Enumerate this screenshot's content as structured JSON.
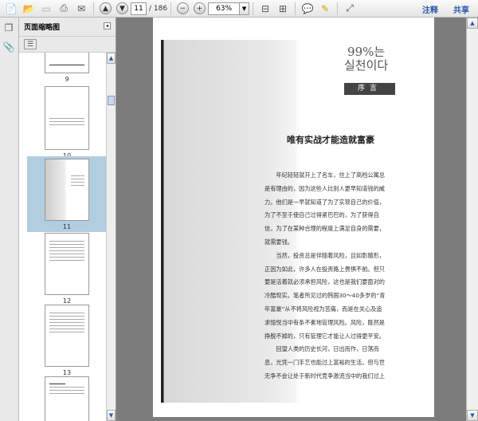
{
  "toolbar": {
    "current_page": "11",
    "total_pages": "/ 186",
    "zoom": "63%",
    "annotate": "注释",
    "share": "共享"
  },
  "sidebar": {
    "title": "页面缩略图",
    "thumbnails": [
      {
        "label": "9"
      },
      {
        "label": "10"
      },
      {
        "label": "11"
      },
      {
        "label": "12"
      },
      {
        "label": "13"
      }
    ]
  },
  "document": {
    "korean_title": [
      "99%는",
      "실천이다"
    ],
    "section": "序言",
    "heading": "唯有实战才能造就富豪",
    "lines": [
      "　　年纪轻轻就开上了名车，住上了高档公寓总",
      "是有理由的，因为这些人比别人更早知道钱的威",
      "力。他们是一早就知道了为了实现自己的价值，",
      "为了不至于使自己过得紧巴巴的，为了获得自",
      "信，为了在某种合理的程度上满足自身的需要，",
      "就需要钱。",
      "　　当然，投资总是伴随着风险，且如影随形，",
      "正因为如此，许多人在投资路上畏惧不前。但只",
      "要是活着就必须承担风险，这也是我们要面对的",
      "冷酷现实。笔者所见过的韩国30～40多岁的“青",
      "年富豪”从不将风险视为苦痛，而是在关心及追",
      "求愉悦当中有条不紊地管理风险。风险，既然是",
      "挣脱不掉的，只有管理它才能让人过得更平安。",
      "　　回望人类的历史长河，日出而作，日落而",
      "息，光凭一门手艺也能过上富裕的生活。但与世",
      "无争不会让处于新时代竞争激流当中的我们过上"
    ]
  }
}
